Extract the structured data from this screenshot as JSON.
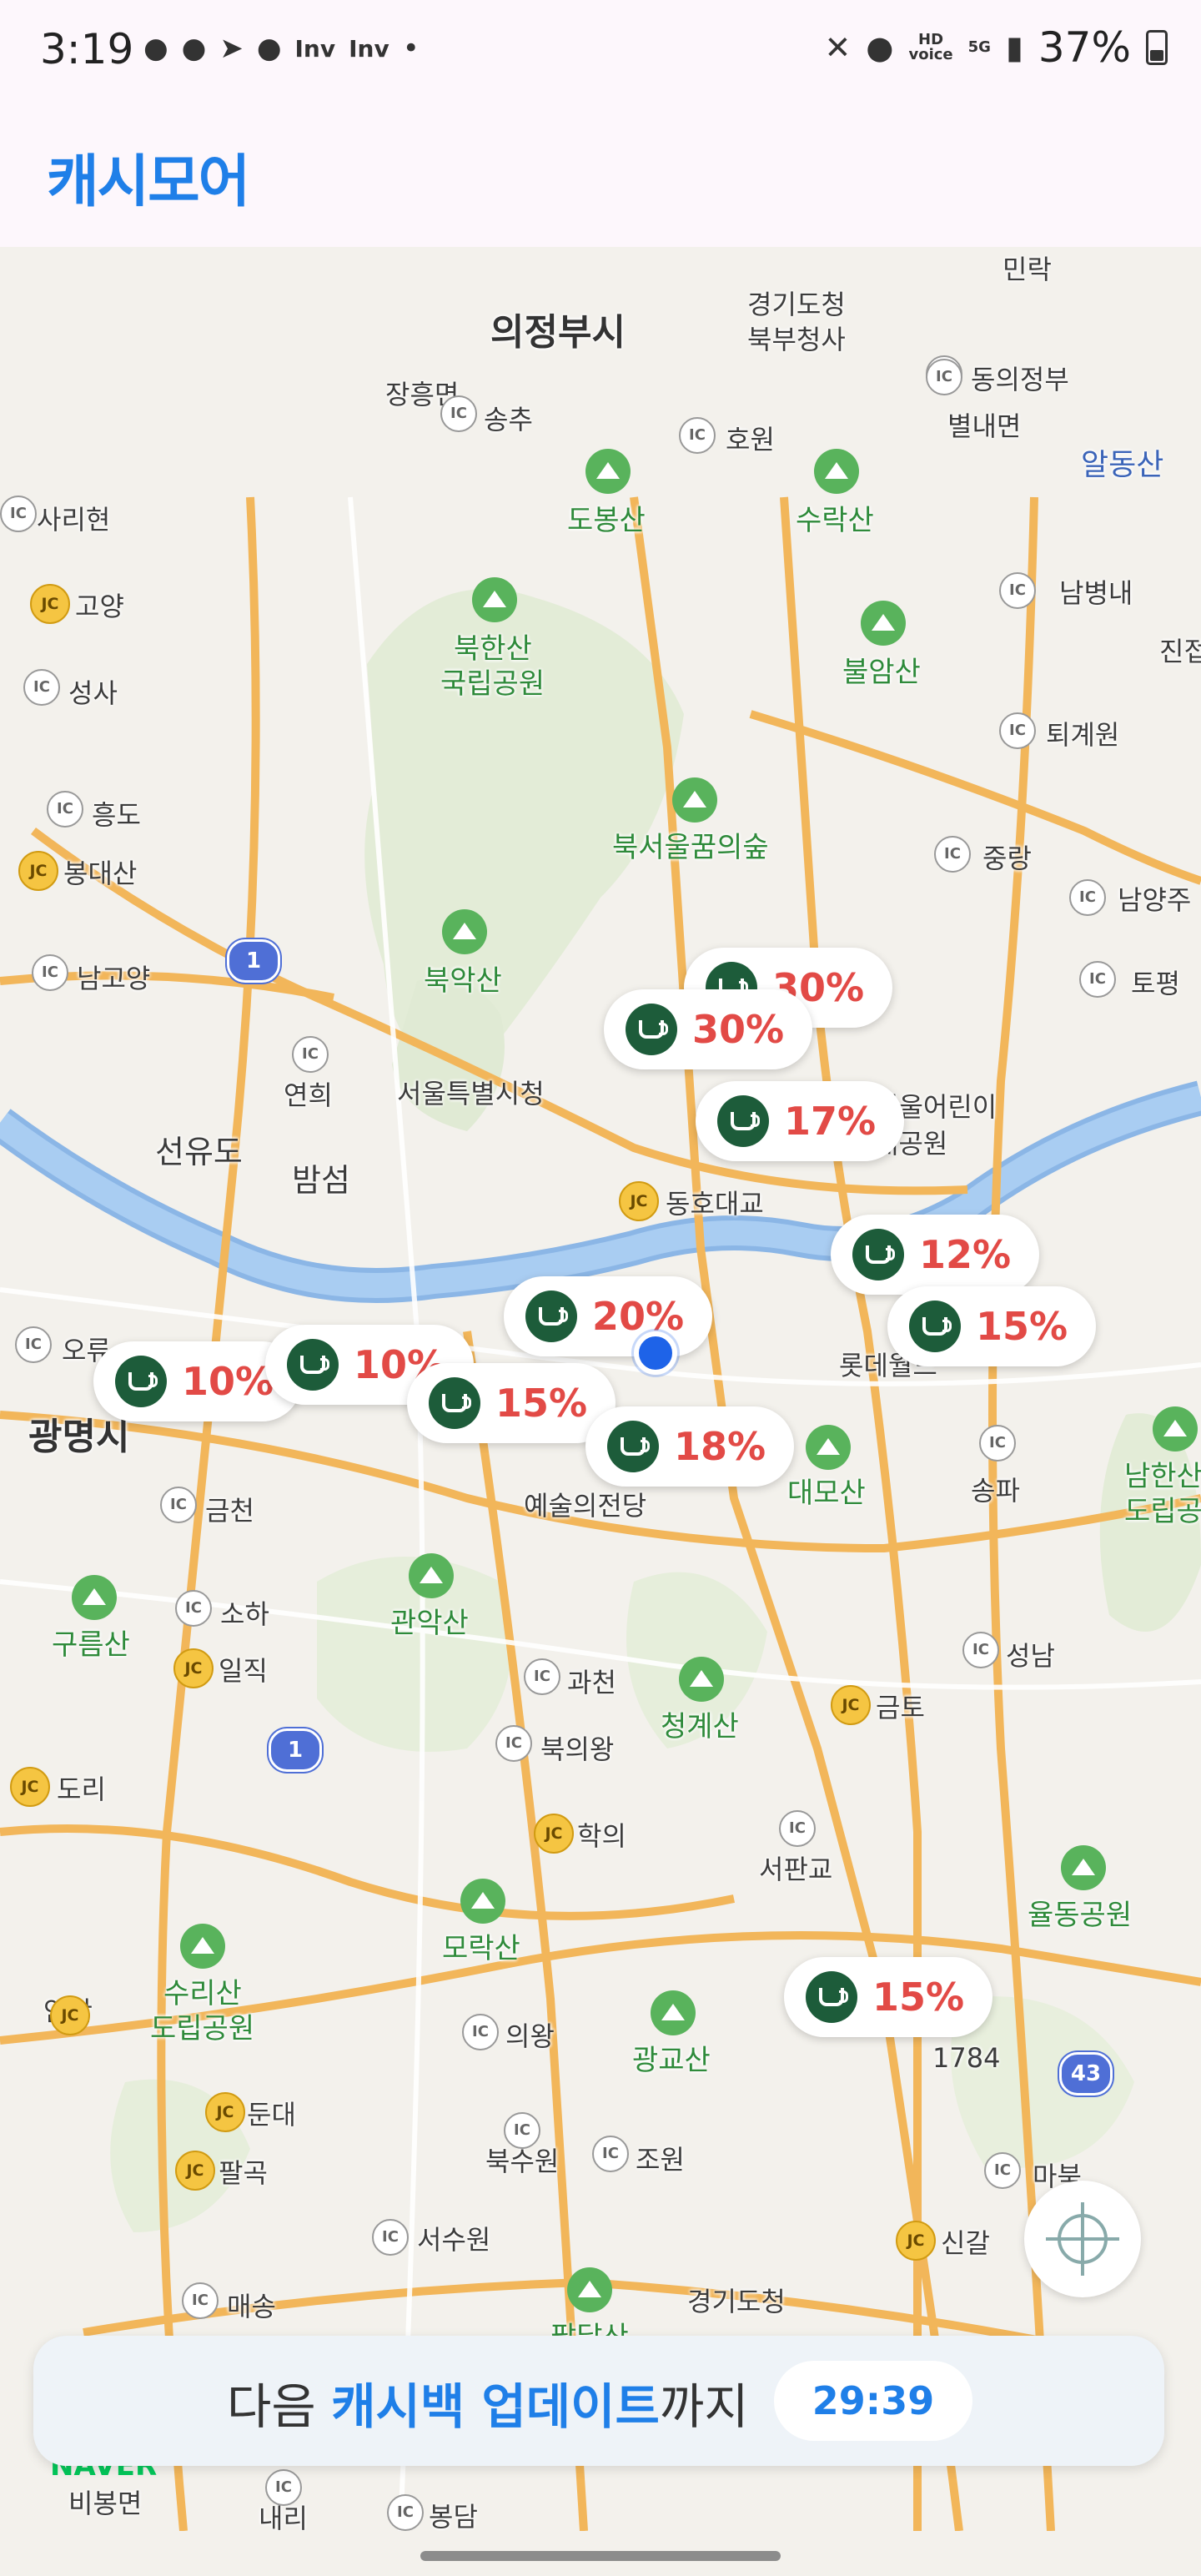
{
  "status_bar": {
    "time": "3:19",
    "left_icons": [
      "talk-icon",
      "chat-icon",
      "telegram-icon",
      "messenger-icon",
      "inv-icon",
      "inv-icon",
      "dot-icon"
    ],
    "inv1": "Inv",
    "inv2": "Inv",
    "hd_label": "HD",
    "voice_label": "voice",
    "network": "5G",
    "battery": "37%"
  },
  "app": {
    "title": "캐시모어"
  },
  "map": {
    "places_big": [
      "의정부시",
      "광명시"
    ],
    "places": [
      "경기도청",
      "북부청사",
      "장흥면",
      "송추",
      "호원",
      "동의정부",
      "별내면",
      "사리현",
      "고양",
      "성사",
      "흥도",
      "봉대산",
      "남고양",
      "연희",
      "서울특별시청",
      "선유도",
      "밤섬",
      "동호대교",
      "서울어린이",
      "대공원",
      "오류",
      "금천",
      "소하",
      "일직",
      "도리",
      "안산",
      "둔대",
      "팔곡",
      "매송",
      "비봉면",
      "내리",
      "봉담",
      "서수원",
      "의왕",
      "북수원",
      "조원",
      "경기도청",
      "신갈",
      "마북",
      "서판교",
      "과천",
      "북의왕",
      "학의",
      "금토",
      "성남",
      "송파",
      "롯데월드",
      "예술의전당",
      "1784",
      "남양주",
      "토평",
      "중랑",
      "퇴계원",
      "남병내",
      "민락",
      "진접"
    ],
    "mountains": [
      "도봉산",
      "수락산",
      "불암산",
      "북한산",
      "국립공원",
      "북서울꿈의숲",
      "북악산",
      "대모산",
      "관악산",
      "청계산",
      "구름산",
      "모락산",
      "수리산",
      "도립공원",
      "광교산",
      "율동공원",
      "남한산",
      "도립공원",
      "팔달산",
      "알동산"
    ],
    "route_numbers": [
      "1",
      "1",
      "43"
    ],
    "markers": [
      "30%",
      "30%",
      "17%",
      "12%",
      "15%",
      "20%",
      "10%",
      "10%",
      "15%",
      "18%",
      "15%"
    ],
    "naver": "NAVER"
  },
  "banner": {
    "prefix": "다음 ",
    "highlight": "캐시백 업데이트",
    "suffix": "까지",
    "timer": "29:39"
  }
}
